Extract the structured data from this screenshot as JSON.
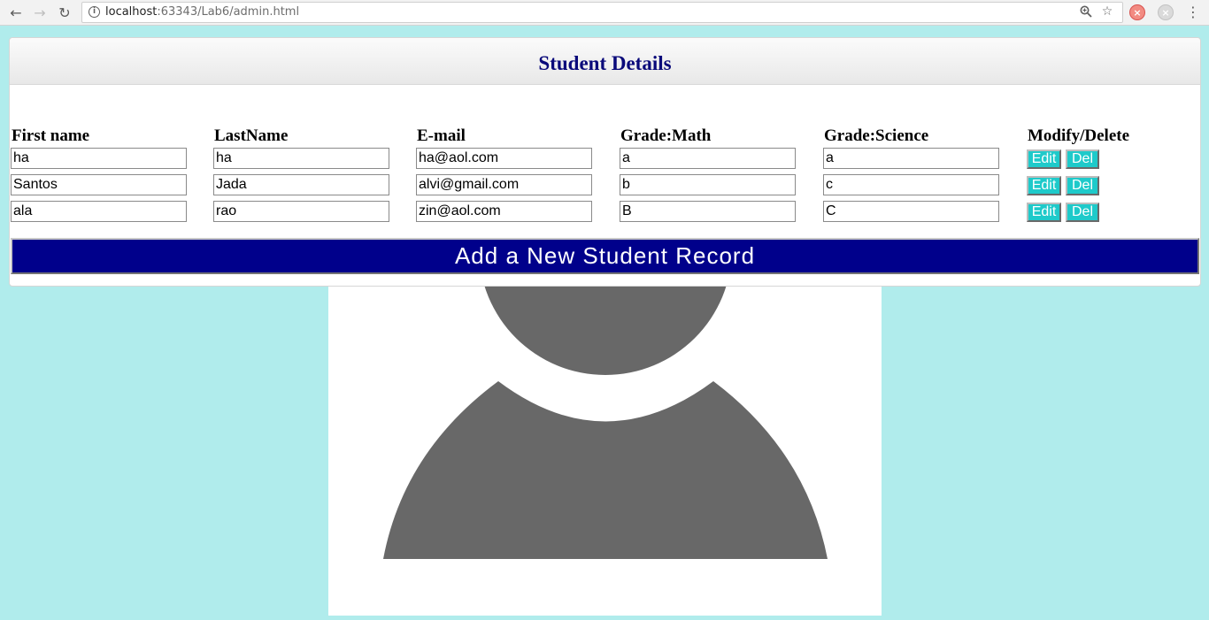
{
  "browser": {
    "url_host": "localhost",
    "url_rest": ":63343/Lab6/admin.html",
    "icons": [
      "back-arrow-icon",
      "forward-arrow-icon",
      "reload-icon",
      "info-icon",
      "zoom-icon",
      "star-icon",
      "extension-blocked-icon",
      "extension-grey-icon",
      "menu-icon"
    ]
  },
  "panel": {
    "title": "Student Details",
    "title_color": "#0a0a7a"
  },
  "table": {
    "headers": [
      "First name",
      "LastName",
      "E-mail",
      "Grade:Math",
      "Grade:Science",
      "Modify/Delete"
    ],
    "rows": [
      [
        "ha",
        "ha",
        "ha@aol.com",
        "a",
        "a"
      ],
      [
        "Santos",
        "Jada",
        "alvi@gmail.com",
        "b",
        "c"
      ],
      [
        "ala",
        "rao",
        "zin@aol.com",
        "B",
        "C"
      ]
    ],
    "edit_label": "Edit",
    "delete_label": "Del",
    "button_color": "#1ecaca"
  },
  "add_button": {
    "label": "Add a New Student Record",
    "color": "#00008b"
  },
  "avatar": {
    "icon": "user-silhouette-icon",
    "color": "#686868"
  },
  "page_background": "#b0ecec"
}
